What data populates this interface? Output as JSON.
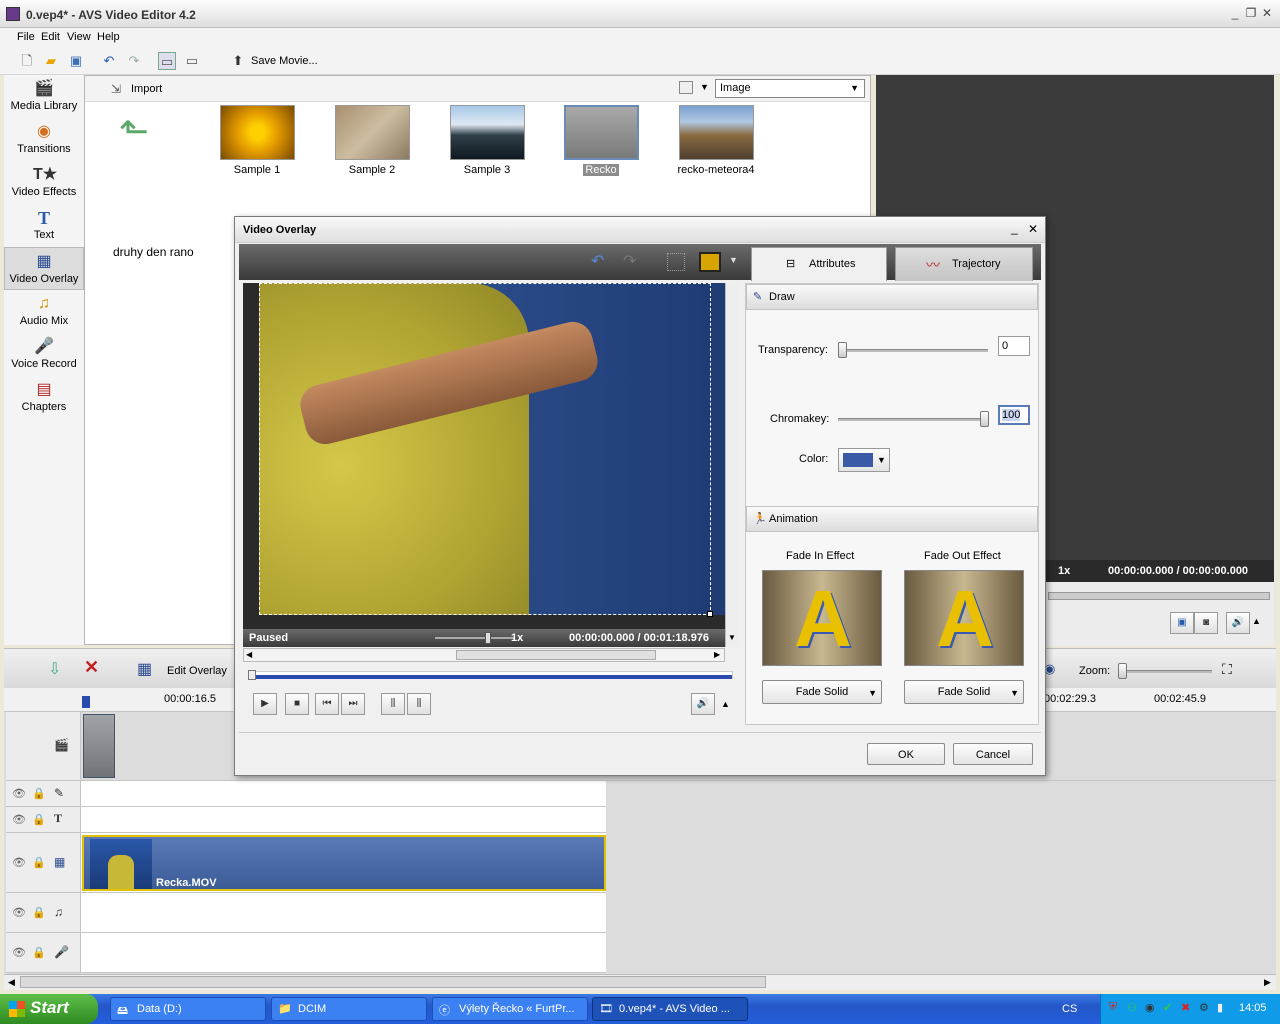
{
  "window": {
    "title": "0.vep4* - AVS Video Editor 4.2"
  },
  "menu": [
    "File",
    "Edit",
    "View",
    "Help"
  ],
  "toolbar": {
    "save_movie": "Save Movie..."
  },
  "sidebar": [
    {
      "label": "Media Library",
      "icon": "media-library-icon"
    },
    {
      "label": "Transitions",
      "icon": "transitions-icon"
    },
    {
      "label": "Video Effects",
      "icon": "video-effects-icon"
    },
    {
      "label": "Text",
      "icon": "text-icon"
    },
    {
      "label": "Video Overlay",
      "icon": "video-overlay-icon"
    },
    {
      "label": "Audio Mix",
      "icon": "audio-mix-icon"
    },
    {
      "label": "Voice Record",
      "icon": "voice-record-icon"
    },
    {
      "label": "Chapters",
      "icon": "chapters-icon"
    }
  ],
  "library": {
    "import_label": "Import",
    "view_select": "Image",
    "items": [
      "Sample 1",
      "Sample 2",
      "Sample 3",
      "Recko",
      "recko-meteora4"
    ],
    "folder_label": "druhy den rano"
  },
  "preview": {
    "speed": "1x",
    "time": "00:00:00.000 / 00:00:00.000"
  },
  "editbar": {
    "edit_overlay": "Edit Overlay",
    "zoom_label": "Zoom:"
  },
  "ruler": {
    "t1": "00:00:16.5",
    "t2": "00:02:29.3",
    "t3": "00:02:45.9"
  },
  "timeline": {
    "clip_name": "Recka.MOV"
  },
  "dialog": {
    "title": "Video Overlay",
    "tabs": {
      "attributes": "Attributes",
      "trajectory": "Trajectory"
    },
    "draw": {
      "header": "Draw",
      "transparency_label": "Transparency:",
      "transparency_value": "0",
      "chromakey_label": "Chromakey:",
      "chromakey_value": "100",
      "color_label": "Color:",
      "color": "#3a5aa8"
    },
    "animation": {
      "header": "Animation",
      "fade_in_label": "Fade In Effect",
      "fade_out_label": "Fade Out Effect",
      "fade_in_value": "Fade Solid",
      "fade_out_value": "Fade Solid"
    },
    "player": {
      "status": "Paused",
      "speed": "1x",
      "time": "00:00:00.000 / 00:01:18.976"
    },
    "ok": "OK",
    "cancel": "Cancel"
  },
  "taskbar": {
    "start": "Start",
    "tasks": [
      "Data (D:)",
      "DCIM",
      "Výlety Řecko « FurtPr...",
      "0.vep4* - AVS Video ..."
    ],
    "lang": "CS",
    "clock": "14:05"
  }
}
